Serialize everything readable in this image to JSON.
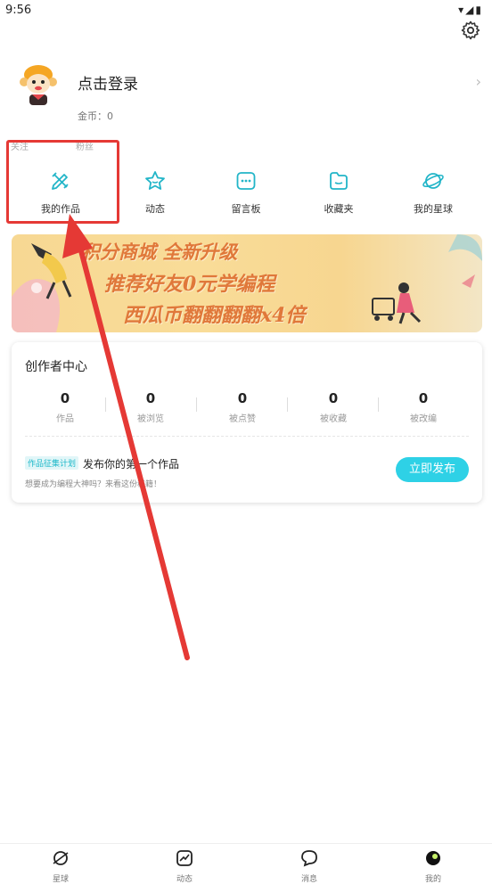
{
  "status_bar": {
    "time": "9:56",
    "icons": "▾◢▮"
  },
  "profile": {
    "login_text": "点击登录",
    "coins": "金币：0",
    "follow_label": "关注",
    "fans_label": "粉丝"
  },
  "quick_actions": [
    {
      "label": "我的作品",
      "icon": "pencil-ruler-icon"
    },
    {
      "label": "动态",
      "icon": "star-icon"
    },
    {
      "label": "留言板",
      "icon": "message-icon"
    },
    {
      "label": "收藏夹",
      "icon": "folder-icon"
    },
    {
      "label": "我的星球",
      "icon": "planet-icon"
    }
  ],
  "banner": {
    "line1": "积分商城  全新升级",
    "line2": "推荐好友0元学编程",
    "line3": "西瓜币翻翻翻翻x4倍"
  },
  "creator_center": {
    "title": "创作者中心",
    "stats": [
      {
        "value": "0",
        "label": "作品"
      },
      {
        "value": "0",
        "label": "被浏览"
      },
      {
        "value": "0",
        "label": "被点赞"
      },
      {
        "value": "0",
        "label": "被收藏"
      },
      {
        "value": "0",
        "label": "被改编"
      }
    ],
    "tag": "作品征集计划",
    "publish_title": "发布你的第一个作品",
    "publish_sub": "想要成为编程大神吗？来看这份秘籍！",
    "publish_button": "立即发布"
  },
  "bottom_nav": [
    {
      "label": "星球",
      "icon": "planet-nav-icon"
    },
    {
      "label": "动态",
      "icon": "trend-nav-icon"
    },
    {
      "label": "消息",
      "icon": "chat-nav-icon"
    },
    {
      "label": "我的",
      "icon": "me-nav-icon"
    }
  ],
  "colors": {
    "accent": "#2ed1e6",
    "highlight": "#e53935",
    "banner_text": "#e0783a"
  }
}
